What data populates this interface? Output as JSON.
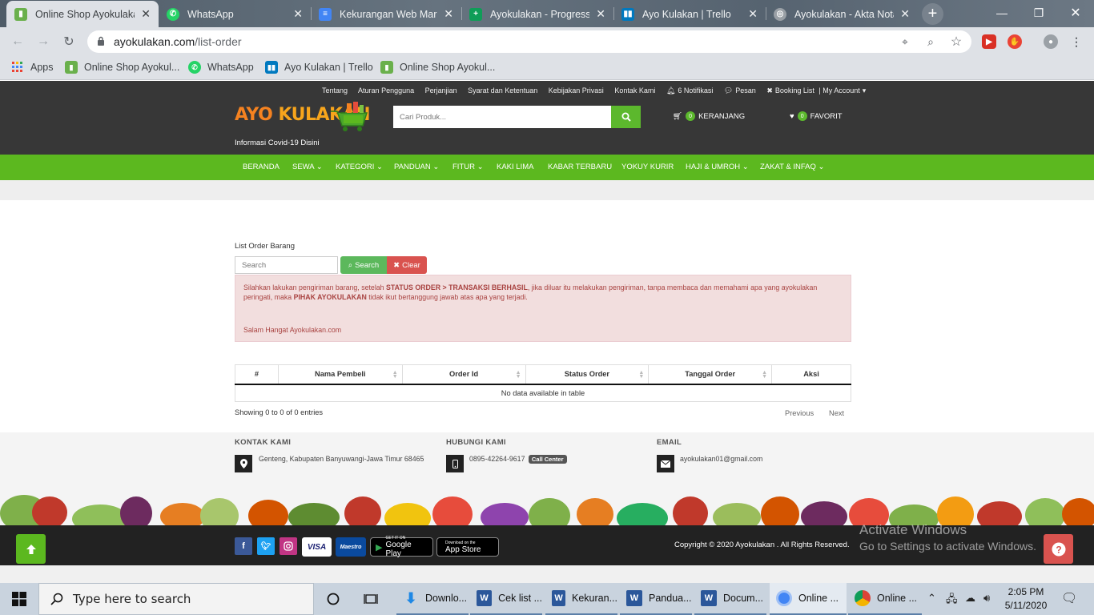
{
  "browser": {
    "tabs": [
      {
        "label": "Online Shop Ayokulakan",
        "icon": "ayokulakan-favicon",
        "color": "#6ab04c"
      },
      {
        "label": "WhatsApp",
        "icon": "whatsapp-favicon",
        "color": "#25d366"
      },
      {
        "label": "Kekurangan Web Mark",
        "icon": "google-docs-favicon",
        "color": "#4285f4"
      },
      {
        "label": "Ayokulakan - Progress",
        "icon": "google-sheets-favicon",
        "color": "#0f9d58"
      },
      {
        "label": "Ayo Kulakan | Trello",
        "icon": "trello-favicon",
        "color": "#0079bf"
      },
      {
        "label": "Ayokulakan - Akta Nota",
        "icon": "globe-favicon",
        "color": "#9aa0a6"
      }
    ],
    "url_domain": "ayokulakan.com",
    "url_path": "/list-order",
    "bookmarks": [
      {
        "label": "Apps",
        "icon": "apps-grid-icon"
      },
      {
        "label": "Online Shop Ayokul...",
        "icon": "ayokulakan-favicon"
      },
      {
        "label": "WhatsApp",
        "icon": "whatsapp-favicon"
      },
      {
        "label": "Ayo Kulakan | Trello",
        "icon": "trello-favicon"
      },
      {
        "label": "Online Shop Ayokul...",
        "icon": "ayokulakan-favicon"
      }
    ]
  },
  "site": {
    "top_links": [
      "Tentang",
      "Aturan Pengguna",
      "Perjanjian",
      "Syarat dan Ketentuan",
      "Kebijakan Privasi",
      "Kontak Kami",
      "6 Notifikasi",
      "Pesan",
      "Booking List",
      "| My Account"
    ],
    "logo": {
      "part1": "AYO ",
      "part2": "KULAKAN"
    },
    "covid_link": "Informasi Covid-19 Disini",
    "search_placeholder": "Cari Produk...",
    "cart": {
      "count": "0",
      "label": "KERANJANG"
    },
    "favorite": {
      "count": "0",
      "label": "FAVORIT"
    },
    "nav": [
      "BERANDA",
      "SEWA",
      "KATEGORI",
      "PANDUAN",
      "FITUR",
      "KAKI LIMA",
      "KABAR TERBARU",
      "YOKUY KURIR",
      "HAJI & UMROH",
      "ZAKAT & INFAQ"
    ],
    "accent_green": "#5cb81f",
    "header_dark": "#373737"
  },
  "content": {
    "page_label": "List Order Barang",
    "search_placeholder": "Search",
    "search_button": "Search",
    "clear_button": "Clear",
    "alert": {
      "t1": "Silahkan lakukan pengiriman barang, setelah ",
      "b1": "STATUS ORDER > TRANSAKSI BERHASIL",
      "t2": ", jika diluar itu melakukan pengiriman, tanpa membaca dan memahami apa yang ayokulakan peringati, maka ",
      "b2": "PIHAK AYOKULAKAN",
      "t3": " tidak ikut bertanggung jawab atas apa yang terjadi.",
      "greeting": "Salam Hangat Ayokulakan.com"
    },
    "table": {
      "columns": [
        "#",
        "Nama Pembeli",
        "Order Id",
        "Status Order",
        "Tanggal Order",
        "Aksi"
      ],
      "empty": "No data available in table",
      "info": "Showing 0 to 0 of 0 entries",
      "prev": "Previous",
      "next": "Next"
    }
  },
  "footer": {
    "kontak": {
      "title": "KONTAK KAMI",
      "text": "Genteng, Kabupaten Banyuwangi-Jawa Timur 68465"
    },
    "hubungi": {
      "title": "HUBUNGI KAMI",
      "text": "0895-42264-9617",
      "badge": "Call Center"
    },
    "email": {
      "title": "EMAIL",
      "text": "ayokulakan01@gmail.com"
    },
    "payments": [
      "VISA",
      "Maestro"
    ],
    "stores": [
      {
        "small": "GET IT ON",
        "big": "Google Play"
      },
      {
        "small": "Download on the",
        "big": "App Store"
      }
    ],
    "copyright": "Copyright © 2020 Ayokulakan . All Rights Reserved.",
    "activate_title": "Activate Windows",
    "activate_sub": "Go to Settings to activate Windows."
  },
  "taskbar": {
    "search_text": "Type here to search",
    "apps": [
      {
        "label": "Downlo...",
        "icon": "download-icon",
        "color": "#1e88e5"
      },
      {
        "label": "Cek list ...",
        "icon": "word-icon",
        "color": "#2b579a"
      },
      {
        "label": "Kekuran...",
        "icon": "word-icon",
        "color": "#2b579a"
      },
      {
        "label": "Pandua...",
        "icon": "word-icon",
        "color": "#2b579a"
      },
      {
        "label": "Docum...",
        "icon": "word-icon",
        "color": "#2b579a"
      },
      {
        "label": "Online ...",
        "icon": "chrome-icon",
        "color": "#4285f4"
      },
      {
        "label": "Online ...",
        "icon": "chrome-icon",
        "color": "#db4437"
      }
    ],
    "time": "2:05 PM",
    "date": "5/11/2020"
  }
}
